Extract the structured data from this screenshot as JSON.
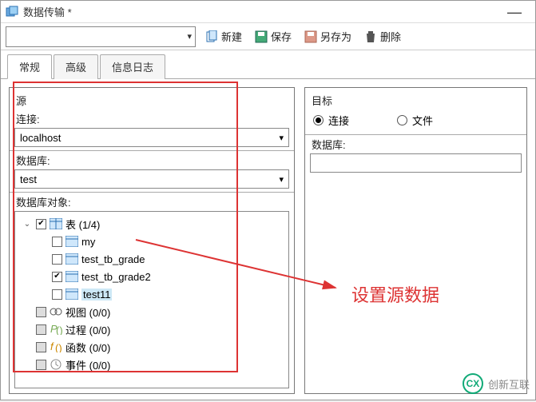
{
  "window": {
    "title": "数据传输 *"
  },
  "toolbar": {
    "new": "新建",
    "save": "保存",
    "save_as": "另存为",
    "delete": "删除"
  },
  "tabs": {
    "general": "常规",
    "advanced": "高级",
    "log": "信息日志"
  },
  "source": {
    "title": "源",
    "connection_label": "连接:",
    "connection_value": "localhost",
    "database_label": "数据库:",
    "database_value": "test",
    "objects_label": "数据库对象:",
    "tree": {
      "tables_label": "表  (1/4)",
      "items": [
        "my",
        "test_tb_grade",
        "test_tb_grade2",
        "test11"
      ],
      "views": "视图  (0/0)",
      "procs": "过程  (0/0)",
      "funcs": "函数  (0/0)",
      "events": "事件  (0/0)"
    }
  },
  "target": {
    "title": "目标",
    "radio_conn": "连接",
    "radio_file": "文件",
    "database_label": "数据库:"
  },
  "annotation": "设置源数据",
  "watermark": "创新互联"
}
